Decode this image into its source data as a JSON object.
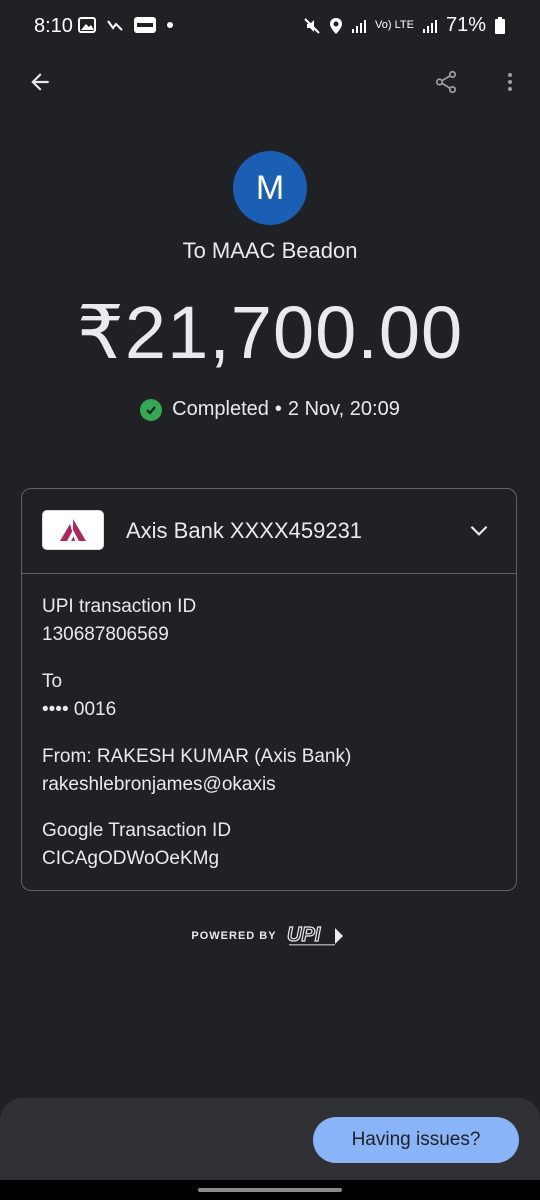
{
  "status_bar": {
    "time": "8:10",
    "network": "Vo) LTE",
    "battery": "71%"
  },
  "header": {
    "avatar_letter": "M",
    "payee": "To MAAC Beadon",
    "amount": "₹21,700.00",
    "status": "Completed",
    "separator": "•",
    "datetime": "2 Nov, 20:09"
  },
  "card": {
    "bank_account": "Axis Bank XXXX459231",
    "fields": [
      {
        "label": "UPI transaction ID",
        "value": "130687806569"
      },
      {
        "label": "To",
        "value": "•••• 0016"
      },
      {
        "label": "From: RAKESH KUMAR (Axis Bank)",
        "value": "rakeshlebronjames@okaxis"
      },
      {
        "label": "Google Transaction ID",
        "value": "CICAgODWoOeKMg"
      }
    ]
  },
  "footer": {
    "powered_by": "POWERED BY",
    "upi_logo_text": "UPI",
    "help_button": "Having issues?"
  },
  "colors": {
    "background": "#202124",
    "avatar": "#1a5fb4",
    "success": "#34a853",
    "help_button": "#8ab4f8",
    "axis_brand": "#ae275f"
  },
  "icons": [
    "back-arrow-icon",
    "share-icon",
    "more-vert-icon",
    "check-circle-icon",
    "chevron-down-icon",
    "axis-bank-logo"
  ]
}
